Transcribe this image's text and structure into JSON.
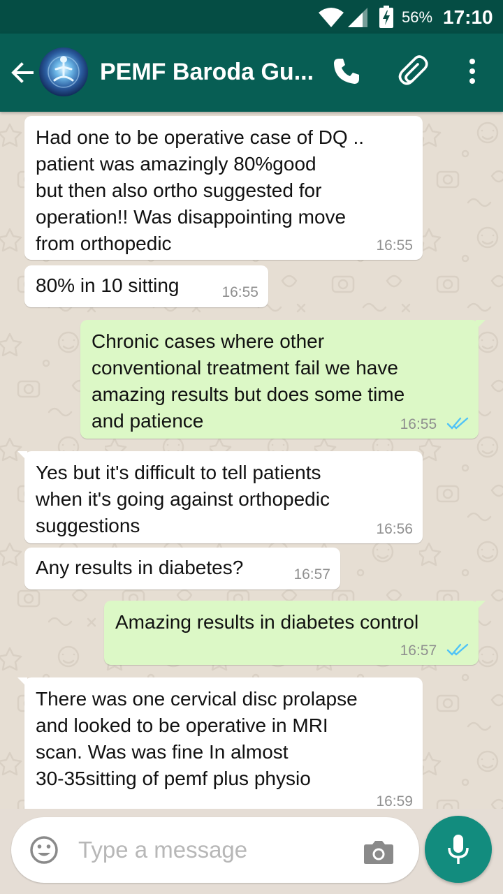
{
  "status_bar": {
    "battery_percent": "56%",
    "time": "17:10"
  },
  "header": {
    "title": "PEMF Baroda Gu..."
  },
  "messages": [
    {
      "direction": "in",
      "text": "Had one to be operative case of DQ ..\npatient was amazingly 80%good\nbut then also ortho suggested for\noperation!! Was disappointing move\nfrom orthopedic",
      "time": "16:55"
    },
    {
      "direction": "in",
      "text": "80% in 10 sitting",
      "time": "16:55"
    },
    {
      "direction": "out",
      "text": "Chronic cases where other\nconventional treatment fail we have\namazing results but does some time\nand patience",
      "time": "16:55",
      "status": "read"
    },
    {
      "direction": "in",
      "text": "Yes but it's difficult to tell patients\nwhen it's going against orthopedic\nsuggestions",
      "time": "16:56"
    },
    {
      "direction": "in",
      "text": "Any results in diabetes?",
      "time": "16:57"
    },
    {
      "direction": "out",
      "text": "Amazing results in diabetes control",
      "time": "16:57",
      "status": "read"
    },
    {
      "direction": "in",
      "text": "There was one cervical disc prolapse\nand looked to be operative in MRI\nscan. Was was fine In almost\n30-35sitting of pemf plus physio",
      "time": "16:59"
    }
  ],
  "composer": {
    "placeholder": "Type a message"
  },
  "colors": {
    "header": "#075e54",
    "status_bar": "#054d44",
    "outgoing_bubble": "#dcf8c6",
    "incoming_bubble": "#ffffff",
    "fab": "#128c7e",
    "read_ticks": "#4fc3f7"
  },
  "icons": {
    "back": "arrow-left-icon",
    "call": "phone-icon",
    "attach": "paperclip-icon",
    "more": "more-vertical-icon",
    "emoji": "emoji-icon",
    "camera": "camera-icon",
    "mic": "microphone-icon",
    "ticks": "double-check-icon"
  }
}
